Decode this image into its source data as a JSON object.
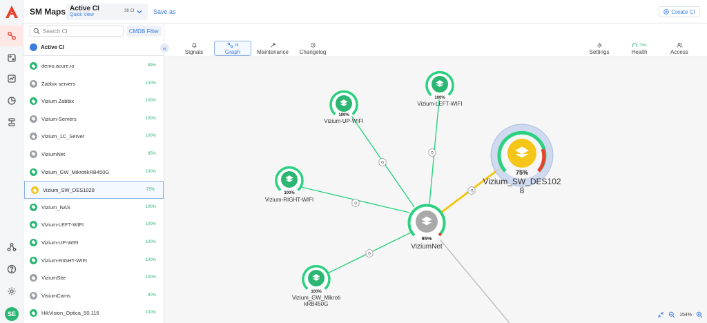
{
  "header": {
    "app_title": "SM Maps",
    "ci_selector": {
      "title": "Active CI",
      "subtitle": "Quick View",
      "count": "38 CI"
    },
    "save_as": "Save as",
    "create_ci": "Create CI"
  },
  "sidebar": {
    "search_placeholder": "Search CI",
    "cmdb_filter": "CMDB Filter",
    "active_ci_label": "Active CI",
    "items": [
      {
        "name": "demo.acure.io",
        "pct": "99%",
        "color": "#2bb673"
      },
      {
        "name": "Zabbix servers",
        "pct": "100%",
        "color": "#9aa0a6"
      },
      {
        "name": "Vizium Zabbix",
        "pct": "100%",
        "color": "#2bb673"
      },
      {
        "name": "Vizium-Servers",
        "pct": "100%",
        "color": "#9aa0a6"
      },
      {
        "name": "Vizium_1C_Server",
        "pct": "100%",
        "color": "#9aa0a6"
      },
      {
        "name": "ViziumNet",
        "pct": "95%",
        "color": "#9aa0a6"
      },
      {
        "name": "Vizium_GW_MikrotikRB450G",
        "pct": "100%",
        "color": "#2bb673"
      },
      {
        "name": "Vizium_SW_DES1028",
        "pct": "75%",
        "color": "#f5c518"
      },
      {
        "name": "Vizium_NAS",
        "pct": "100%",
        "color": "#2bb673"
      },
      {
        "name": "Vizium-LEFT-WIFI",
        "pct": "100%",
        "color": "#2bb673"
      },
      {
        "name": "Vizium-UP-WIFI",
        "pct": "100%",
        "color": "#2bb673"
      },
      {
        "name": "Vizium-RIGHT-WIFI",
        "pct": "100%",
        "color": "#2bb673"
      },
      {
        "name": "ViziumSite",
        "pct": "100%",
        "color": "#9aa0a6"
      },
      {
        "name": "VisiumCams",
        "pct": "90%",
        "color": "#9aa0a6"
      },
      {
        "name": "HikVision_Optica_50.116",
        "pct": "100%",
        "color": "#2bb673"
      }
    ]
  },
  "toolbar": {
    "signals": "Signals",
    "graph": "Graph",
    "graph_count": "38",
    "maintenance": "Maintenance",
    "changelog": "Changelog",
    "settings": "Settings",
    "health": "Health",
    "health_pct": "75%",
    "access": "Access"
  },
  "graph": {
    "nodes": {
      "up_wifi": {
        "label": "Vizium-UP-WIFI",
        "pct": "100%"
      },
      "left_wifi": {
        "label": "Vizium-LEFT-WIFI",
        "pct": "100%"
      },
      "right_wifi": {
        "label": "Vizium-RIGHT-WIFI",
        "pct": "100%"
      },
      "gw": {
        "label_line1": "Vizium_GW_Mikroti",
        "label_line2": "kRB450G",
        "pct": "100%"
      },
      "sw": {
        "label_line1": "Vizium_SW_DES102",
        "label_line2": "8",
        "pct": "75%"
      },
      "net": {
        "label": "ViziumNet",
        "pct": "95%"
      }
    },
    "edges": {
      "up": "0",
      "left": "0",
      "right": "0",
      "gw": "0",
      "sw": "-5"
    }
  },
  "zoom": {
    "level": "154%"
  },
  "user": {
    "initials": "SE"
  },
  "colors": {
    "ok": "#2bb673",
    "warn": "#f5c518",
    "critical": "#e8412c",
    "neutral": "#9aa0a6",
    "accent": "#3b7ddd"
  }
}
